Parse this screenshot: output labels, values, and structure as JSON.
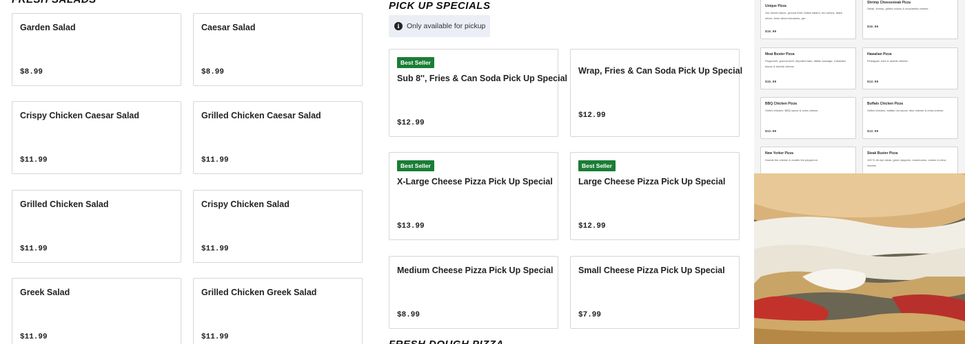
{
  "salads": {
    "heading": "FRESH SALADS",
    "items": [
      {
        "name": "Garden Salad",
        "price": "$8.99"
      },
      {
        "name": "Caesar Salad",
        "price": "$8.99"
      },
      {
        "name": "Crispy Chicken Caesar Salad",
        "price": "$11.99"
      },
      {
        "name": "Grilled Chicken Caesar Salad",
        "price": "$11.99"
      },
      {
        "name": "Grilled Chicken Salad",
        "price": "$11.99"
      },
      {
        "name": "Crispy Chicken Salad",
        "price": "$11.99"
      },
      {
        "name": "Greek Salad",
        "price": "$11.99"
      },
      {
        "name": "Grilled Chicken Greek Salad",
        "price": "$11.99"
      }
    ]
  },
  "specials": {
    "heading": "PICK UP SPECIALS",
    "notice": "Only available for pickup",
    "items": [
      {
        "name": "Sub 8'', Fries & Can Soda Pick Up Special",
        "price": "$12.99",
        "badge": "Best Seller"
      },
      {
        "name": "Wrap, Fries & Can Soda Pick Up Special",
        "price": "$12.99",
        "badge": ""
      },
      {
        "name": "X-Large Cheese Pizza Pick Up Special",
        "price": "$13.99",
        "badge": "Best Seller"
      },
      {
        "name": "Large Cheese Pizza Pick Up Special",
        "price": "$12.99",
        "badge": "Best Seller"
      },
      {
        "name": "Medium Cheese Pizza Pick Up Special",
        "price": "$8.99",
        "badge": ""
      },
      {
        "name": "Small Cheese Pizza Pick Up Special",
        "price": "$7.99",
        "badge": ""
      }
    ]
  },
  "next_section": {
    "heading": "FRESH DOUGH PIZZA"
  },
  "menu_image": {
    "cards": [
      {
        "name": "Unique Pizza",
        "desc": "Our secret sauce, ground beef, Italian salami, red onions, black olives, fresh sliced tomatoes, gre...",
        "price": "$15.99"
      },
      {
        "name": "Shrimp Cheesesteak Pizza",
        "desc": "Steak, shrimp, grilled onions & mozzarella cheese.",
        "price": "$15.99"
      },
      {
        "name": "Meat Buster Pizza",
        "desc": "Pepperoni, ground beef, imported ham, Italian sausage, Canadian bacon & double cheese.",
        "price": "$15.99"
      },
      {
        "name": "Hawaiian Pizza",
        "desc": "Pineapple, ham & double cheese.",
        "price": "$14.99"
      },
      {
        "name": "BBQ Chicken Pizza",
        "desc": "Grilled chicken, BBQ sauce & extra cheese.",
        "price": "$13.99"
      },
      {
        "name": "Buffalo Chicken Pizza",
        "desc": "Grilled chicken, buffalo hot sauce, blue cheese & extra cheese.",
        "price": "$13.99"
      },
      {
        "name": "New Yorker Pizza",
        "desc": "Double the cheese & double the pepperoni.",
        "price": ""
      },
      {
        "name": "Steak Buster Pizza",
        "desc": "100 % rib eye steak, green peppers, mushrooms, onions & extra cheese.",
        "price": ""
      }
    ]
  }
}
